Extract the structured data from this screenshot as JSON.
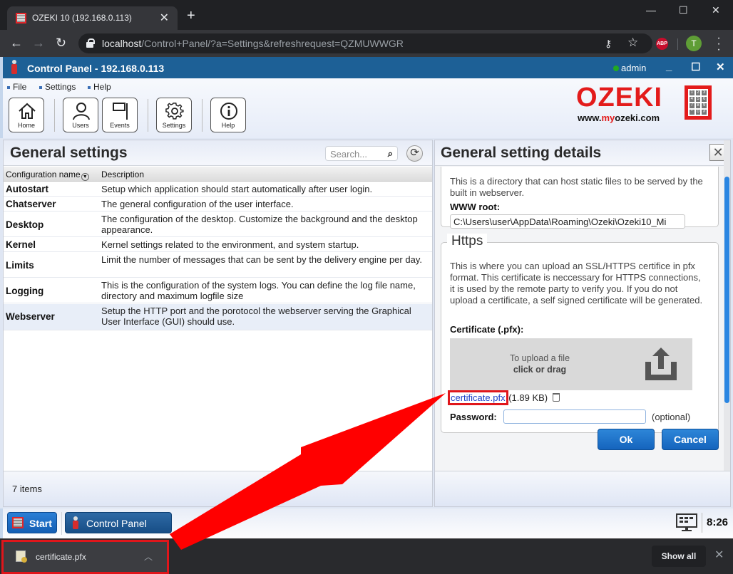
{
  "browser": {
    "tab_title": "OZEKI 10 (192.168.0.113)",
    "url_host": "localhost",
    "url_path": "/Control+Panel/?a=Settings&refreshrequest=QZMUWWGR",
    "profile_initial": "T",
    "abp_label": "ABP"
  },
  "app": {
    "title": "Control Panel - 192.168.0.113",
    "user": "admin",
    "status_color": "#22aa22",
    "accent_color": "#1d6096"
  },
  "menu": {
    "items": [
      {
        "label": "File"
      },
      {
        "label": "Settings"
      },
      {
        "label": "Help"
      }
    ]
  },
  "toolbar": {
    "buttons": [
      {
        "label": "Home",
        "icon": "home-icon"
      },
      {
        "label": "Users",
        "icon": "user-icon"
      },
      {
        "label": "Events",
        "icon": "flag-icon"
      },
      {
        "label": "Settings",
        "icon": "gear-icon"
      },
      {
        "label": "Help",
        "icon": "info-icon"
      }
    ]
  },
  "logo": {
    "word": "OZEKI",
    "site_prefix": "www.",
    "site_my": "my",
    "site_suffix": "ozeki.com",
    "keys": [
      "1",
      "2",
      "3",
      "4",
      "5",
      "6",
      "7",
      "8",
      "9",
      "*",
      "0",
      "#"
    ]
  },
  "general_settings": {
    "title": "General settings",
    "search_placeholder": "Search...",
    "columns": {
      "name": "Configuration name",
      "description": "Description"
    },
    "rows": [
      {
        "name": "Autostart",
        "description": "Setup which application should start automatically after user login."
      },
      {
        "name": "Chatserver",
        "description": "The general configuration of the user interface."
      },
      {
        "name": "Desktop",
        "description": "The configuration of the desktop. Customize the background and the desktop appearance."
      },
      {
        "name": "Kernel",
        "description": "Kernel settings related to the environment, and system startup."
      },
      {
        "name": "Limits",
        "description": "Limit the number of messages that can be sent by the delivery engine per day."
      },
      {
        "name": "Logging",
        "description": "This is the configuration of the system logs. You can define the log file name, directory and maximum logfile size"
      },
      {
        "name": "Webserver",
        "description": "Setup the HTTP port and the porotocol the webserver serving the Graphical User Interface (GUI) should use."
      }
    ],
    "selected_row": "Webserver",
    "item_count": "7 items"
  },
  "details": {
    "title": "General setting details",
    "www_description": "This is a directory that can host static files to be served by the built in webserver.",
    "www_root_label": "WWW root:",
    "www_root_value": "C:\\Users\\user\\AppData\\Roaming\\Ozeki\\Ozeki10_Mi",
    "https_legend": "Https",
    "https_description": "This is where you can upload an SSL/HTTPS certifice in pfx format. This certificate is neccessary for HTTPS connections, it is used by the remote party to verify you. If you do not upload a certificate, a self signed certificate will be generated.",
    "certificate_label": "Certificate (.pfx):",
    "upload_line1": "To upload a file",
    "upload_line2": "click or drag",
    "file_name": "certificate.pfx",
    "file_size": "(1.89 KB)",
    "password_label": "Password:",
    "password_value": "",
    "password_hint": "(optional)",
    "ok_label": "Ok",
    "cancel_label": "Cancel",
    "scroll_position": 0.35
  },
  "taskbar": {
    "start_label": "Start",
    "window_label": "Control Panel",
    "clock": "8:26"
  },
  "downloads": {
    "file_name": "certificate.pfx",
    "show_all_label": "Show all"
  },
  "annotation": {
    "color": "#ff0000"
  }
}
